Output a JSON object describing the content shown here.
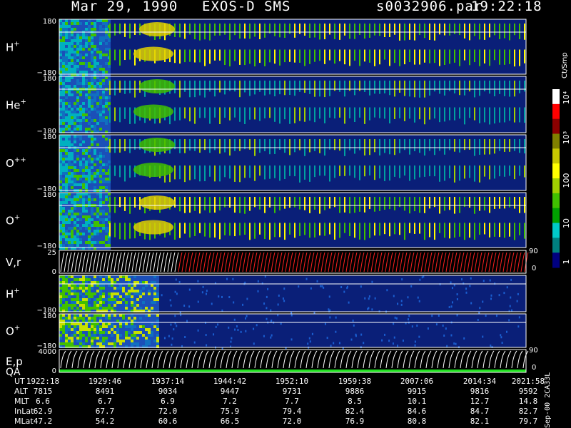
{
  "header": {
    "date": "Mar 29, 1990",
    "instrument": "EXOS-D SMS",
    "file": "s0032906.par",
    "time": "19:22:18"
  },
  "colorbar": {
    "unit": "Ct/Smp",
    "ticks": [
      "10⁴",
      "10³",
      "100",
      "10",
      "1"
    ],
    "colors": [
      "#ffffff",
      "#ff0000",
      "#8b0000",
      "#808000",
      "#c8c800",
      "#ffff00",
      "#a0d000",
      "#40c000",
      "#00a000",
      "#00c8c8",
      "#008080",
      "#000080"
    ]
  },
  "panels": [
    {
      "id": "h-plus-upper",
      "label": "H",
      "sup": "+",
      "top": "180",
      "bottom": "−180"
    },
    {
      "id": "he-plus",
      "label": "He",
      "sup": "+",
      "top": "180",
      "bottom": "−180"
    },
    {
      "id": "o-plusplus",
      "label": "O",
      "sup": "++",
      "top": "180",
      "bottom": "−180"
    },
    {
      "id": "o-plus-upper",
      "label": "O",
      "sup": "+",
      "top": "180",
      "bottom": "−180"
    },
    {
      "id": "v-r",
      "label": "V,r",
      "sup": "",
      "top": "25",
      "bottom": "0",
      "right_top": "90",
      "right_bottom": "0"
    },
    {
      "id": "h-plus-lower",
      "label": "H",
      "sup": "+",
      "top": "",
      "bottom": "−180"
    },
    {
      "id": "o-plus-lower",
      "label": "O",
      "sup": "+",
      "top": "180",
      "bottom": "−180"
    },
    {
      "id": "e-p",
      "label": "E,p",
      "sup": "",
      "label2": "QA",
      "top": "4000",
      "bottom": "0",
      "right_top": "90",
      "right_bottom": "0"
    }
  ],
  "footer": {
    "rows": [
      {
        "name": "UT",
        "values": [
          "1922:18",
          "1929:46",
          "1937:14",
          "1944:42",
          "1952:10",
          "1959:38",
          "2007:06",
          "2014:34",
          "2021:58"
        ]
      },
      {
        "name": "ALT",
        "values": [
          "7815",
          "8491",
          "9034",
          "9447",
          "9731",
          "9886",
          "9915",
          "9816",
          "9592"
        ]
      },
      {
        "name": "MLT",
        "values": [
          "6.6",
          "6.7",
          "6.9",
          "7.2",
          "7.7",
          "8.5",
          "10.1",
          "12.7",
          "14.8"
        ]
      },
      {
        "name": "InLat",
        "values": [
          "62.9",
          "67.7",
          "72.0",
          "75.9",
          "79.4",
          "82.4",
          "84.6",
          "84.7",
          "82.7"
        ]
      },
      {
        "name": "MLat",
        "values": [
          "47.2",
          "54.2",
          "60.6",
          "66.5",
          "72.0",
          "76.9",
          "80.8",
          "82.1",
          "79.7"
        ]
      }
    ],
    "side": "Sep-00 2CA33L"
  },
  "chart_data": {
    "type": "heatmap",
    "title": "Mar 29, 1990 EXOS-D SMS",
    "x_ticks_ut": [
      "1922:18",
      "1929:46",
      "1937:14",
      "1944:42",
      "1952:10",
      "1959:38",
      "2007:06",
      "2014:34",
      "2021:58"
    ],
    "series": [
      {
        "name": "H+",
        "ylim": [
          -180,
          180
        ]
      },
      {
        "name": "He+",
        "ylim": [
          -180,
          180
        ]
      },
      {
        "name": "O++",
        "ylim": [
          -180,
          180
        ]
      },
      {
        "name": "O+",
        "ylim": [
          -180,
          180
        ]
      },
      {
        "name": "V,r",
        "ylim": [
          0,
          25
        ]
      },
      {
        "name": "H+",
        "ylim": [
          -180,
          180
        ]
      },
      {
        "name": "O+",
        "ylim": [
          -180,
          180
        ]
      },
      {
        "name": "E,p",
        "ylim": [
          0,
          4000
        ]
      }
    ],
    "colorbar_unit": "Ct/Smp",
    "colorbar_ticks": [
      "10^4",
      "10^3",
      "100",
      "10",
      "1"
    ]
  }
}
